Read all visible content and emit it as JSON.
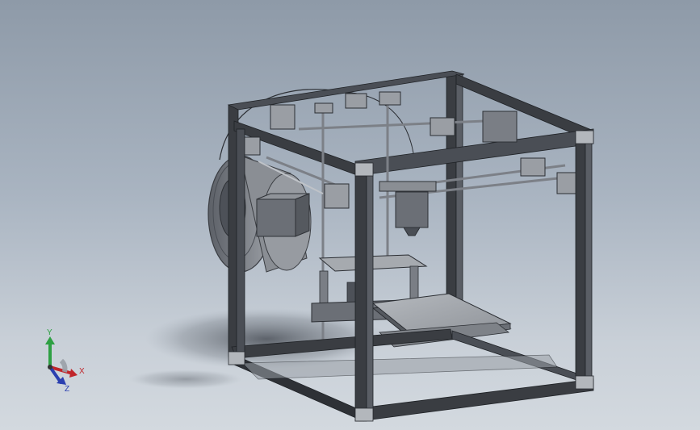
{
  "viewport": {
    "background_top": "#8e9aa8",
    "background_bottom": "#d3d9df",
    "frame_color": "#3a3d42",
    "frame_light": "#6d7178",
    "part_color": "#8a8e94",
    "bed_color": "#9ea2a8"
  },
  "triad": {
    "x_label": "X",
    "y_label": "Y",
    "z_label": "Z",
    "x_color": "#c0262b",
    "y_color": "#2ea043",
    "z_color": "#2b3fb0"
  }
}
